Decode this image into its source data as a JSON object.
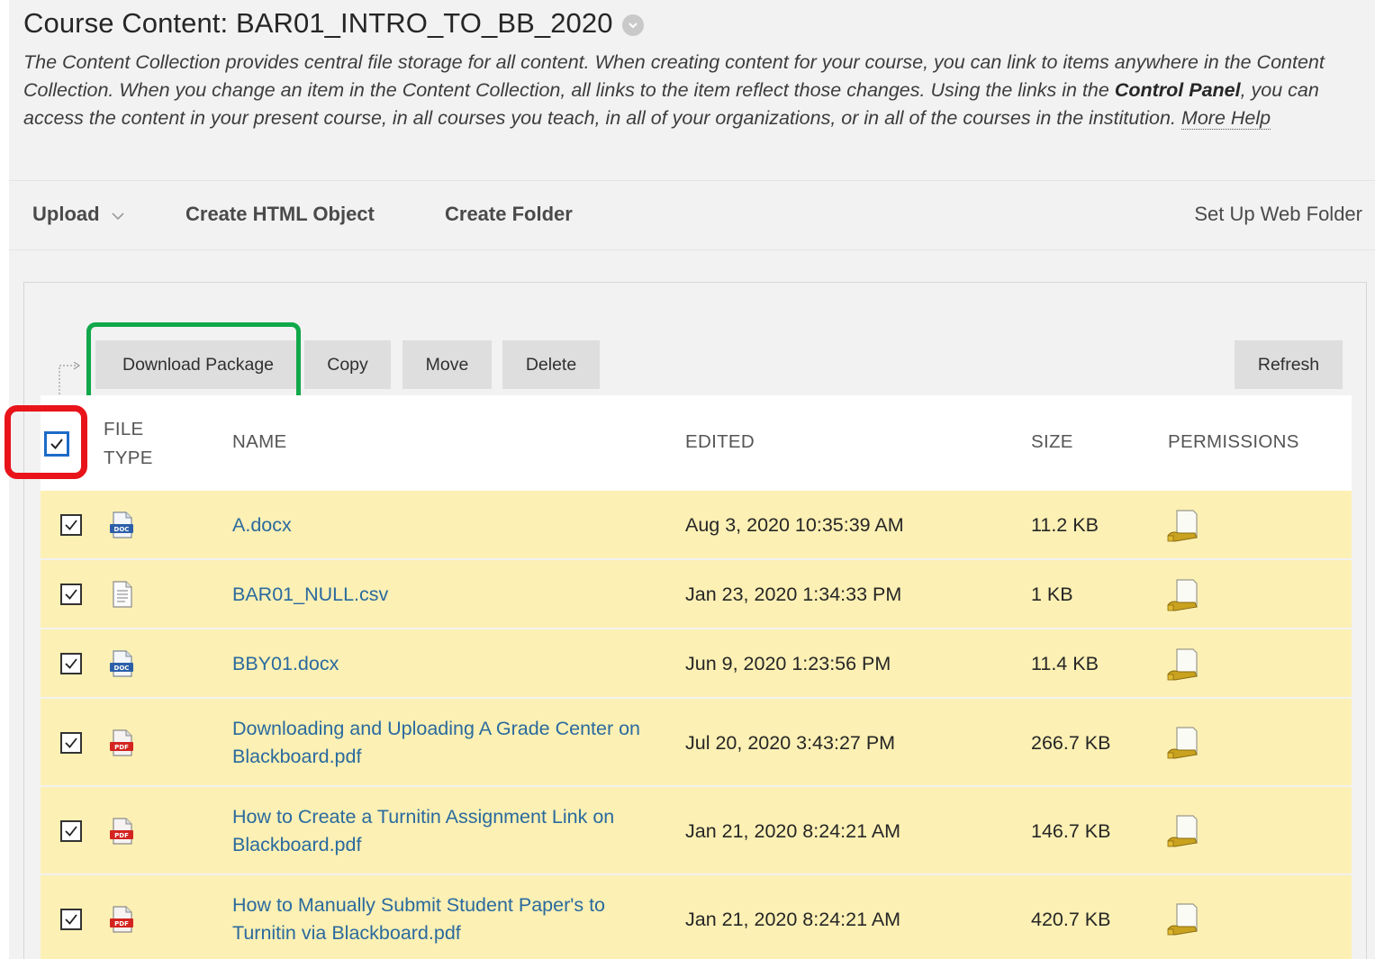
{
  "header": {
    "title": "Course Content: BAR01_INTRO_TO_BB_2020",
    "description_part1": "The Content Collection provides central file storage for all content. When creating content for your course, you can link to items anywhere in the Content Collection. When you change an item in the Content Collection, all links to the item reflect those changes. Using the links in the ",
    "description_bold": "Control Panel",
    "description_part2": ", you can access the content in your present course, in all courses you teach, in all of your organizations, or in all of the courses in the institution. ",
    "more_help": "More Help"
  },
  "action_bar": {
    "upload": "Upload",
    "create_html": "Create HTML Object",
    "create_folder": "Create Folder",
    "web_folder": "Set Up Web Folder"
  },
  "buttons": {
    "download": "Download Package",
    "copy": "Copy",
    "move": "Move",
    "delete": "Delete",
    "refresh": "Refresh"
  },
  "table": {
    "columns": {
      "file_type_line1": "FILE",
      "file_type_line2": "TYPE",
      "name": "NAME",
      "edited": "EDITED",
      "size": "SIZE",
      "permissions": "PERMISSIONS"
    },
    "rows": [
      {
        "type": "doc",
        "name": "A.docx",
        "edited": "Aug 3, 2020 10:35:39 AM",
        "size": "11.2 KB",
        "checked": true
      },
      {
        "type": "text",
        "name": "BAR01_NULL.csv",
        "edited": "Jan 23, 2020 1:34:33 PM",
        "size": "1 KB",
        "checked": true
      },
      {
        "type": "doc",
        "name": "BBY01.docx",
        "edited": "Jun 9, 2020 1:23:56 PM",
        "size": "11.4 KB",
        "checked": true
      },
      {
        "type": "pdf",
        "name": "Downloading and Uploading A Grade Center on Blackboard.pdf",
        "edited": "Jul 20, 2020 3:43:27 PM",
        "size": "266.7 KB",
        "checked": true
      },
      {
        "type": "pdf",
        "name": "How to Create a Turnitin Assignment Link on Blackboard.pdf",
        "edited": "Jan 21, 2020 8:24:21 AM",
        "size": "146.7 KB",
        "checked": true
      },
      {
        "type": "pdf",
        "name": "How to Manually Submit Student Paper's to Turnitin via Blackboard.pdf",
        "edited": "Jan 21, 2020 8:24:21 AM",
        "size": "420.7 KB",
        "checked": true
      }
    ]
  },
  "icons": {
    "doc_label": "DOC",
    "pdf_label": "PDF"
  },
  "colors": {
    "row_highlight": "#fcf0b4",
    "link": "#2a6a9e",
    "annotation_green": "#10a84a",
    "annotation_red": "#e8141a",
    "checkbox_blue": "#1d6bc8"
  }
}
